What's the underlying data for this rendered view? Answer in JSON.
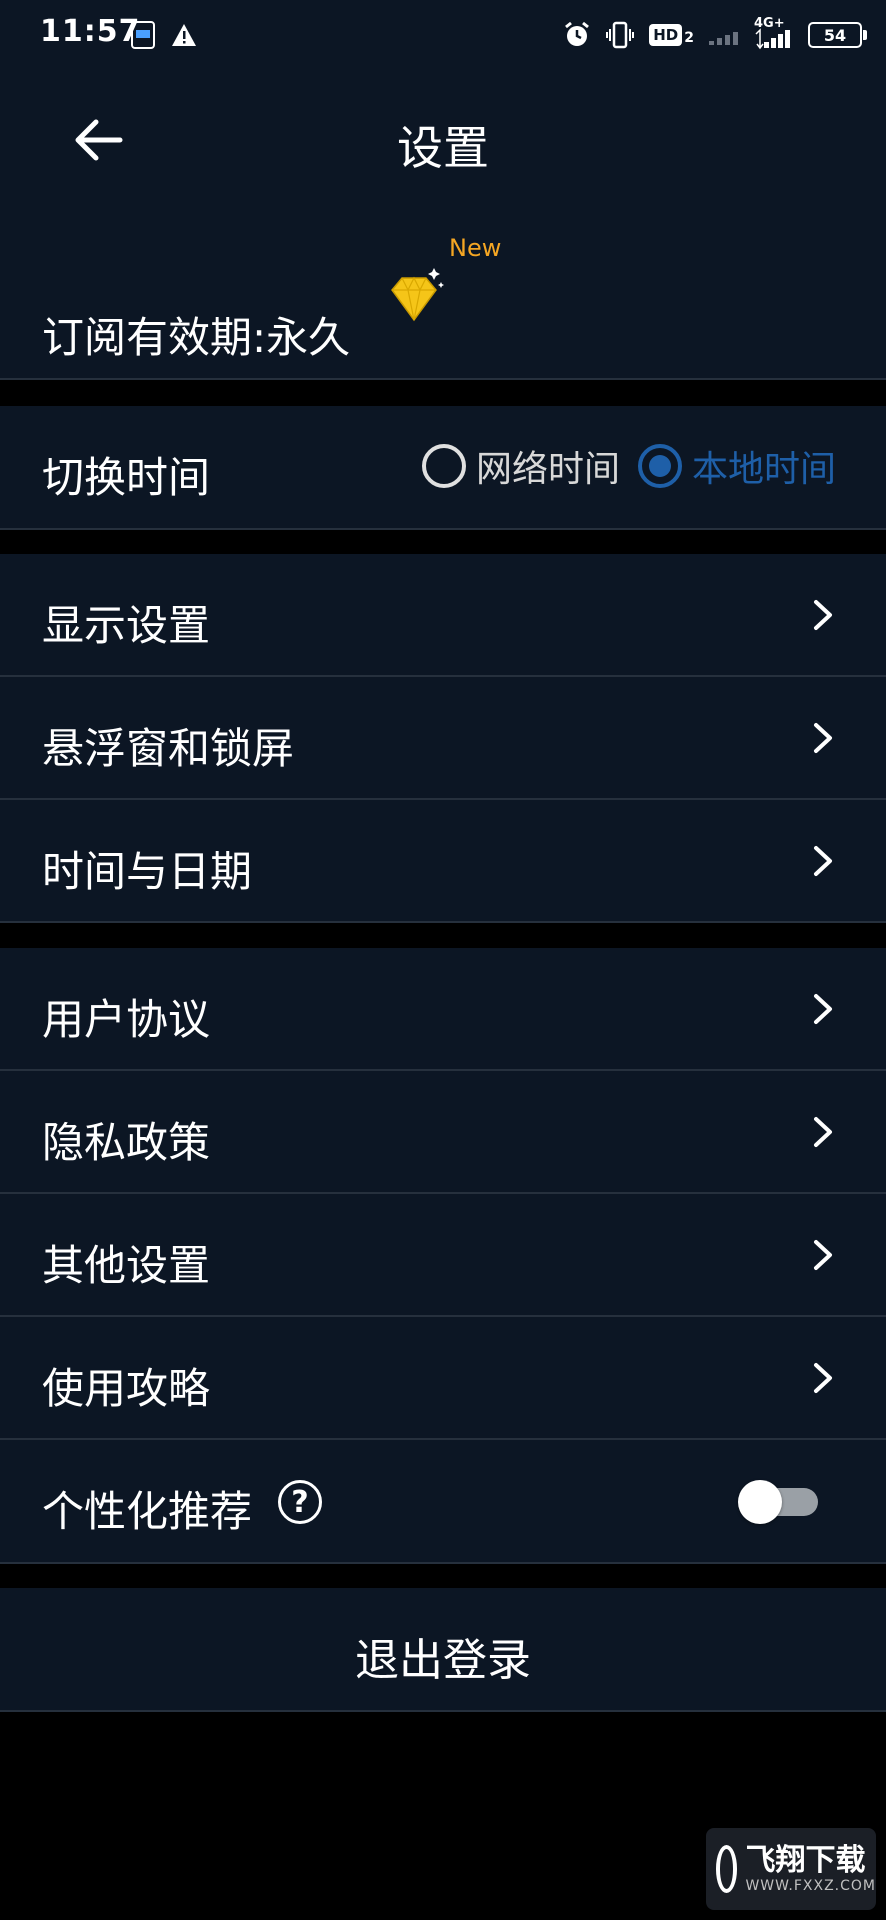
{
  "status_bar": {
    "time": "11:57",
    "left_icons": [
      "clock-app-icon",
      "warning-icon"
    ],
    "right_icons": [
      "alarm-icon",
      "vibrate-icon",
      "hd-icon",
      "signal-icon",
      "4g-signal-icon"
    ],
    "hd_label": "HD",
    "hd_sub": "2",
    "network_label": "4G+",
    "battery": "54"
  },
  "header": {
    "title": "设置",
    "back_icon": "arrow-left-icon"
  },
  "subscription": {
    "label": "订阅有效期:永久",
    "badge": "New",
    "icon": "diamond-icon"
  },
  "time_switch": {
    "label": "切换时间",
    "options": [
      {
        "label": "网络时间",
        "selected": false
      },
      {
        "label": "本地时间",
        "selected": true
      }
    ]
  },
  "group1": [
    {
      "label": "显示设置"
    },
    {
      "label": "悬浮窗和锁屏"
    },
    {
      "label": "时间与日期"
    }
  ],
  "group2": [
    {
      "label": "用户协议"
    },
    {
      "label": "隐私政策"
    },
    {
      "label": "其他设置"
    },
    {
      "label": "使用攻略"
    }
  ],
  "personalized": {
    "label": "个性化推荐",
    "help": "?",
    "enabled": false
  },
  "logout": {
    "label": "退出登录"
  },
  "watermark": {
    "main": "飞翔下载",
    "sub": "WWW.FXXZ.COM"
  },
  "colors": {
    "background": "#000000",
    "surface": "#0c1624",
    "divider": "#26303d",
    "accent": "#1e5fa8",
    "badge": "#f5a623"
  }
}
